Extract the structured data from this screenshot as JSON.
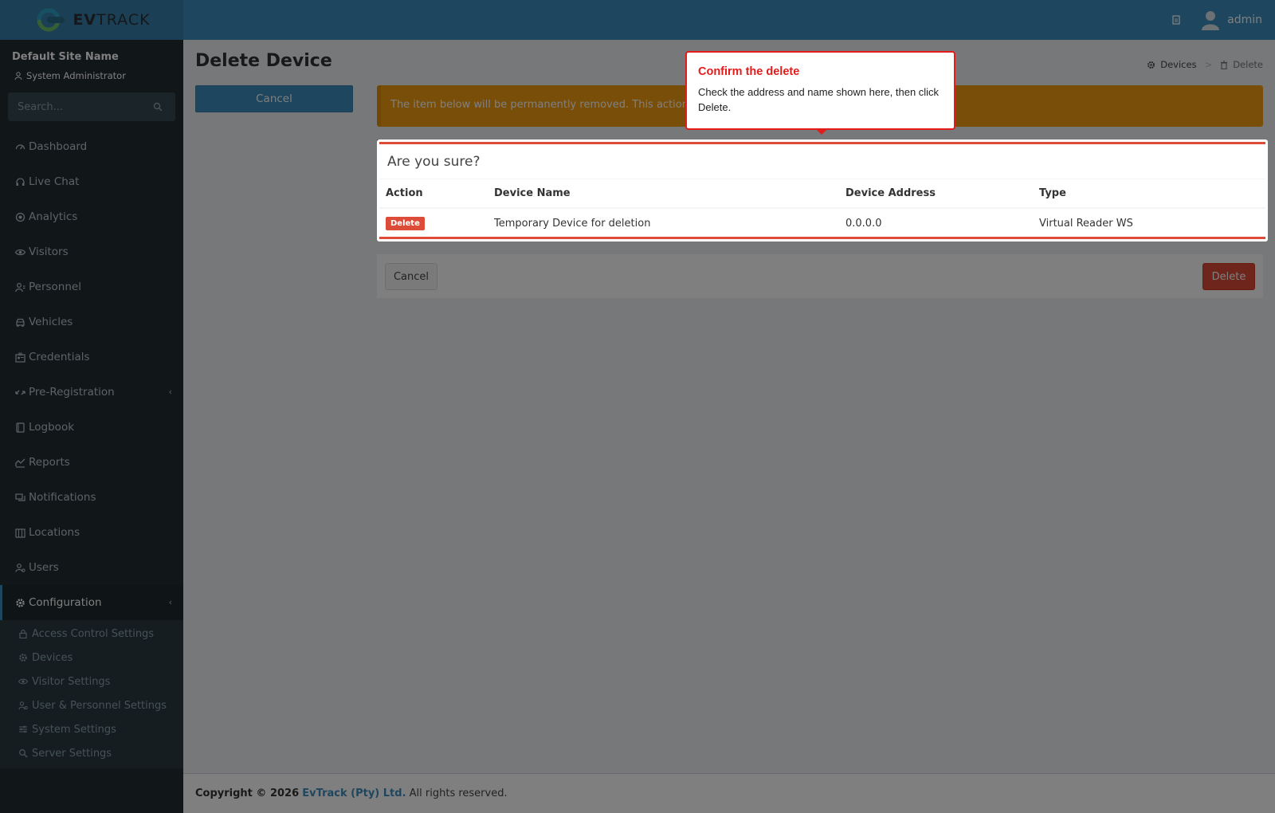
{
  "header": {
    "logo_text_bold": "EV",
    "logo_text_rest": "TRACK",
    "user_name": "admin"
  },
  "sidebar": {
    "site_name": "Default Site Name",
    "role": "System Administrator",
    "search_placeholder": "Search...",
    "items": [
      {
        "label": "Dashboard",
        "icon": "dashboard-icon"
      },
      {
        "label": "Live Chat",
        "icon": "headset-icon"
      },
      {
        "label": "Analytics",
        "icon": "target-icon"
      },
      {
        "label": "Visitors",
        "icon": "eye-icon"
      },
      {
        "label": "Personnel",
        "icon": "person-icon"
      },
      {
        "label": "Vehicles",
        "icon": "car-icon"
      },
      {
        "label": "Credentials",
        "icon": "badge-icon"
      },
      {
        "label": "Pre-Registration",
        "icon": "arrows-icon"
      },
      {
        "label": "Logbook",
        "icon": "book-icon"
      },
      {
        "label": "Reports",
        "icon": "chart-icon"
      },
      {
        "label": "Notifications",
        "icon": "chat-icon"
      },
      {
        "label": "Locations",
        "icon": "map-icon"
      },
      {
        "label": "Users",
        "icon": "users-icon"
      },
      {
        "label": "Configuration",
        "icon": "gear-icon"
      }
    ],
    "submenu": [
      {
        "label": "Access Control Settings",
        "icon": "lock-icon"
      },
      {
        "label": "Devices",
        "icon": "gear-icon"
      },
      {
        "label": "Visitor Settings",
        "icon": "eye-icon"
      },
      {
        "label": "User & Personnel Settings",
        "icon": "users-icon"
      },
      {
        "label": "System Settings",
        "icon": "sliders-icon"
      },
      {
        "label": "Server Settings",
        "icon": "server-icon"
      }
    ]
  },
  "page": {
    "title": "Delete Device",
    "breadcrumb": [
      "Devices",
      "Delete"
    ],
    "cancel_top": "Cancel",
    "alert": "The item below will be permanently removed. This action cannot be undone.",
    "box_title": "Are you sure?",
    "columns": [
      "Action",
      "Device Name",
      "Device Address",
      "Type"
    ],
    "row": {
      "action": "Delete",
      "name": "Temporary Device for deletion",
      "address": "0.0.0.0",
      "type": "Virtual Reader WS"
    },
    "cancel_bottom": "Cancel",
    "delete_bottom": "Delete"
  },
  "footer": {
    "prefix": "Copyright © 2026",
    "company": "EvTrack (Pty) Ltd.",
    "suffix": "All rights reserved."
  },
  "callout": {
    "title": "Confirm the delete",
    "text": "Check the address and name shown here, then click Delete."
  },
  "colors": {
    "header": "#3c8dbc",
    "sidebar": "#222d32",
    "danger": "#dd4b39",
    "warning": "#f39c12",
    "callout": "#e41b1b"
  }
}
